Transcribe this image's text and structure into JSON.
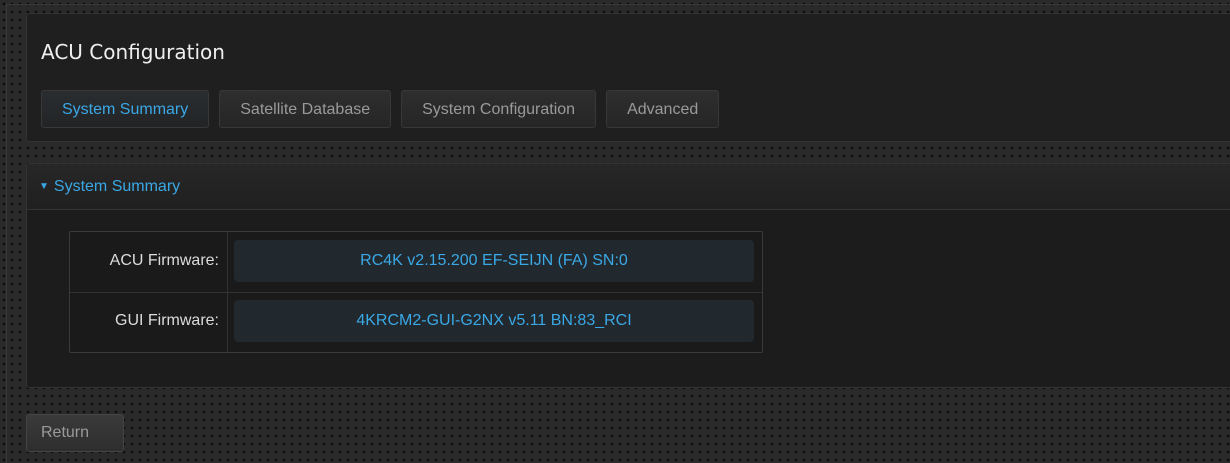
{
  "header": {
    "title": "ACU Configuration",
    "tabs": [
      {
        "label": "System Summary",
        "active": true
      },
      {
        "label": "Satellite Database",
        "active": false
      },
      {
        "label": "System Configuration",
        "active": false
      },
      {
        "label": "Advanced",
        "active": false
      }
    ]
  },
  "summary": {
    "section_title": "System Summary",
    "caret_icon": "caret-down-icon",
    "rows": [
      {
        "label": "ACU Firmware:",
        "value": "RC4K v2.15.200 EF-SEIJN (FA) SN:0"
      },
      {
        "label": "GUI Firmware:",
        "value": "4KRCM2-GUI-G2NX v5.11 BN:83_RCI"
      }
    ]
  },
  "footer": {
    "return_label": "Return"
  },
  "colors": {
    "accent": "#3aa8e6",
    "background": "#2a2a2a",
    "panel": "#1f1f1f",
    "value_box": "#22292e"
  }
}
